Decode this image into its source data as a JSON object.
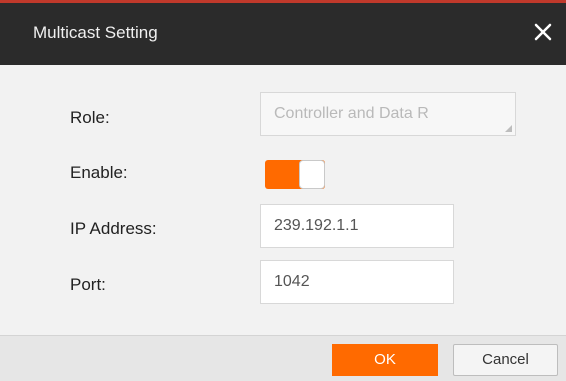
{
  "dialog": {
    "title": "Multicast Setting",
    "close_icon": "close-icon"
  },
  "form": {
    "role": {
      "label": "Role:",
      "value": "Controller and Data R",
      "disabled": true
    },
    "enable": {
      "label": "Enable:",
      "checked": true
    },
    "ip_address": {
      "label": "IP Address:",
      "value": "239.192.1.1"
    },
    "port": {
      "label": "Port:",
      "value": "1042"
    }
  },
  "footer": {
    "ok_label": "OK",
    "cancel_label": "Cancel"
  },
  "colors": {
    "accent": "#ff6a00",
    "title_bar": "#2b2b2b",
    "top_accent": "#c0392b"
  }
}
